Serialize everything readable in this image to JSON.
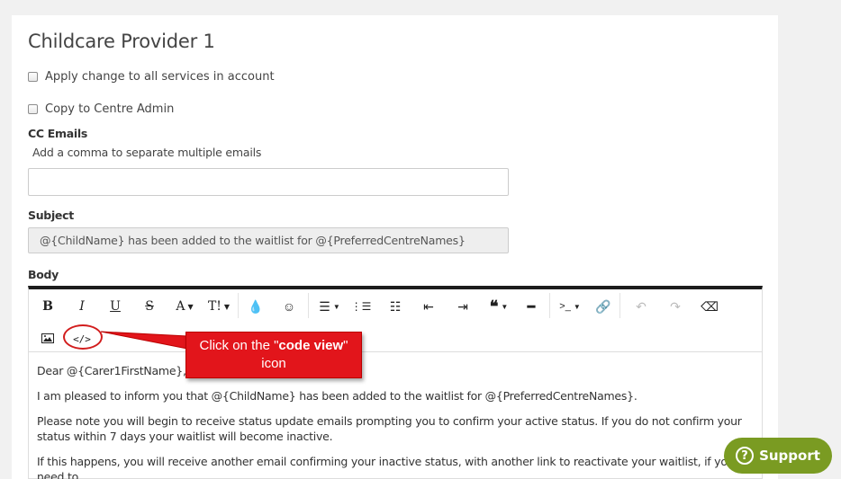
{
  "form": {
    "title": "Childcare Provider 1",
    "apply_all_label": "Apply change to all services in account",
    "copy_admin_label": "Copy to Centre Admin",
    "cc_label": "CC Emails",
    "cc_help": "Add a comma to separate multiple emails",
    "cc_value": "",
    "subject_label": "Subject",
    "subject_value": "@{ChildName} has been added to the waitlist for @{PreferredCentreNames}",
    "body_label": "Body"
  },
  "toolbar": {
    "bold": "B",
    "italic": "I",
    "underline": "U",
    "strike": "S",
    "font_color": "A",
    "font_size": "T!"
  },
  "body": {
    "line1": "Dear @{Carer1FirstName},",
    "line2": "I am pleased to inform you that @{ChildName} has been added to the waitlist for @{PreferredCentreNames}.",
    "line3": "Please note you will begin to receive status update emails prompting you to confirm your active status. If you do not confirm your status within 7 days your waitlist will become inactive.",
    "line4": "If this happens, you will receive another email confirming your inactive status, with another link to reactivate your waitlist, if you need to."
  },
  "callout": {
    "prefix": "Click on the ",
    "quote_open": "\"",
    "strong": "code view",
    "quote_close": "\"",
    "suffix": "icon"
  },
  "support": {
    "label": "Support",
    "icon_glyph": "?"
  },
  "colors": {
    "callout_red": "#e2151b",
    "support_green": "#7a9b22",
    "toolbar_top": "#1c1c1c"
  }
}
